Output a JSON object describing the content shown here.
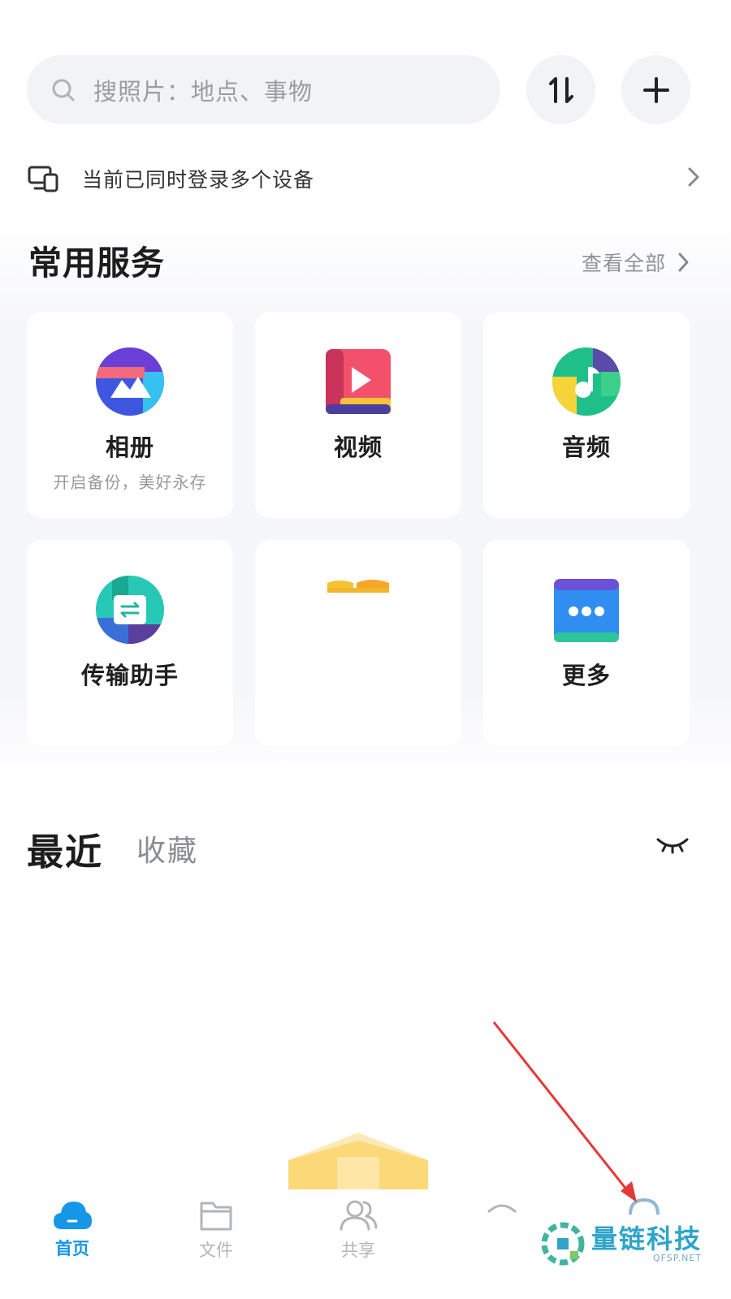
{
  "search": {
    "placeholder": "搜照片：地点、事物"
  },
  "header": {
    "transfer_icon": "sort-transfer-icon",
    "add_icon": "plus-icon"
  },
  "device_notice": {
    "text": "当前已同时登录多个设备"
  },
  "services": {
    "title": "常用服务",
    "view_all": "查看全部",
    "items": [
      {
        "label": "相册",
        "subtitle": "开启备份，美好永存",
        "icon": "album-icon"
      },
      {
        "label": "视频",
        "subtitle": "",
        "icon": "video-icon"
      },
      {
        "label": "音频",
        "subtitle": "",
        "icon": "audio-icon"
      },
      {
        "label": "传输助手",
        "subtitle": "",
        "icon": "transfer-assistant-icon"
      },
      {
        "label": "",
        "subtitle": "",
        "icon": "loading-card-icon"
      },
      {
        "label": "更多",
        "subtitle": "",
        "icon": "more-icon"
      }
    ]
  },
  "recent": {
    "tab_recent": "最近",
    "tab_favorites": "收藏"
  },
  "bottom_nav": {
    "items": [
      {
        "label": "首页",
        "active": true
      },
      {
        "label": "文件",
        "active": false
      },
      {
        "label": "共享",
        "active": false
      },
      {
        "label": "",
        "active": false
      },
      {
        "label": "",
        "active": false
      }
    ]
  },
  "watermark": {
    "text": "量链科技",
    "sub": "QFSP.NET"
  },
  "colors": {
    "accent": "#1696e8",
    "annotation_arrow": "#e53935"
  }
}
